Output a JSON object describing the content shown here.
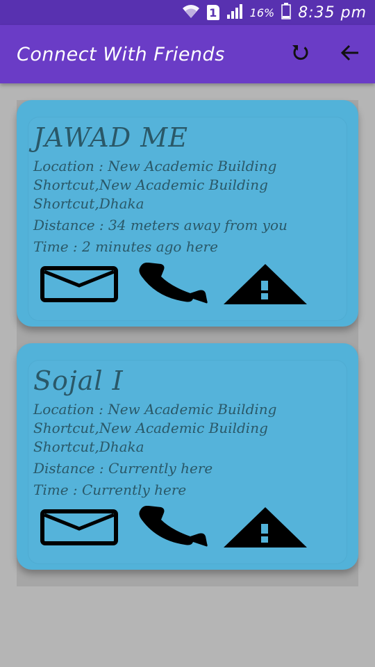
{
  "status_bar": {
    "battery_percent": "16%",
    "time": "8:35 pm",
    "sim_slot": "1",
    "icons": [
      "wifi-icon",
      "sim-icon",
      "signal-icon",
      "battery-icon"
    ]
  },
  "app_bar": {
    "title": "Connect With Friends",
    "actions": [
      "refresh-icon",
      "back-arrow-icon"
    ]
  },
  "colors": {
    "status_bar": "#5831b0",
    "app_bar": "#6a3cc6",
    "card": "#52b2d9",
    "text": "#2a5868",
    "background": "#b5b5b5"
  },
  "friends": [
    {
      "name": "JAWAD ME",
      "location": "Location : New Academic Building Shortcut,New Academic Building Shortcut,Dhaka",
      "distance": "Distance : 34 meters away from you",
      "time": "Time : 2 minutes ago here"
    },
    {
      "name": "Sojal I",
      "location": "Location : New Academic Building Shortcut,New Academic Building Shortcut,Dhaka",
      "distance": "Distance : Currently here",
      "time": "Time : Currently here"
    }
  ],
  "card_actions": [
    "mail-icon",
    "phone-icon",
    "warning-icon"
  ]
}
